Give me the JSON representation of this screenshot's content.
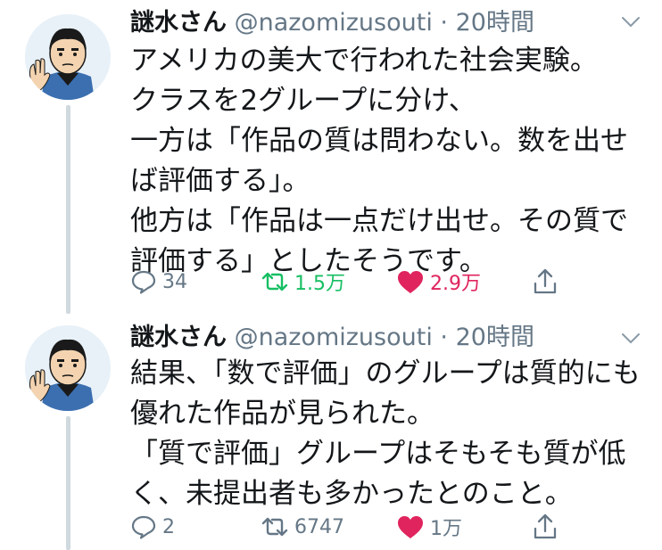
{
  "tweets": [
    {
      "name": "謎水さん",
      "handle": "@nazomizusouti",
      "separator": "·",
      "time": "20時間",
      "lines": [
        "アメリカの美大で行われた社会実験。",
        "クラスを2グループに分け、",
        "一方は「作品の質は問わない。数を出せ",
        "ば評価する」。",
        "他方は「作品は一点だけ出せ。その質で",
        "評価する」としたそうです。"
      ],
      "replies": "34",
      "retweets": "1.5万",
      "likes": "2.9万"
    },
    {
      "name": "謎水さん",
      "handle": "@nazomizusouti",
      "separator": "·",
      "time": "20時間",
      "lines": [
        "結果、「数で評価」のグループは質的にも",
        "優れた作品が見られた。",
        "「質で評価」グループはそもそも質が低",
        "く、未提出者も多かったとのこと。"
      ],
      "replies": "2",
      "retweets": "6747",
      "likes": "1万"
    }
  ],
  "icons": {
    "reply": "reply-icon",
    "retweet": "retweet-icon",
    "like": "heart-icon",
    "share": "share-icon",
    "more": "chevron-down-icon"
  },
  "colors": {
    "retweet_active": "#17bf63",
    "like_active": "#e0245e",
    "muted": "#657786"
  }
}
